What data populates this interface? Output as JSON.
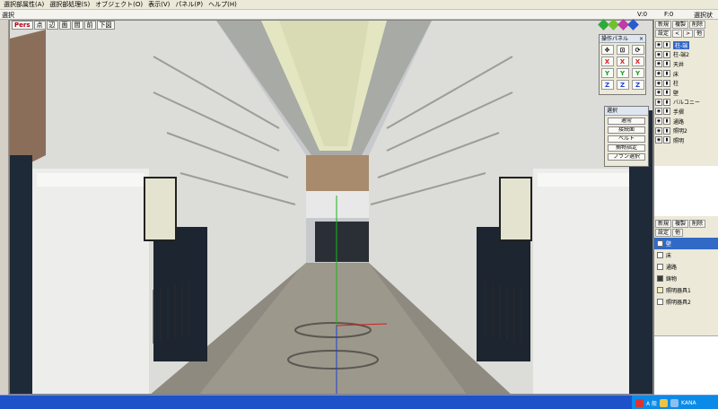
{
  "menu": {
    "items": [
      "選択部属性(A)",
      "選択部処理(S)",
      "オブジェクト(O)",
      "表示(V)",
      "パネル(P)",
      "ヘルプ(H)"
    ]
  },
  "status": {
    "left": "選択",
    "v_label": "V:0",
    "f_label": "F:0",
    "right": "選択状況"
  },
  "viewport_toolbar": {
    "buttons": [
      "Pers",
      "点",
      "辺",
      "面",
      "間",
      "前",
      "下図"
    ]
  },
  "nav_icons": {
    "colors": [
      "#2eaa3a",
      "#6ec12e",
      "#c03aa8",
      "#2a5ad0"
    ]
  },
  "operation_panel": {
    "title": "操作パネル",
    "close_label": "×",
    "row1": [
      "✥",
      "⊡",
      "⟳"
    ],
    "row2": [
      "X",
      "X",
      "X"
    ],
    "row3": [
      "Y",
      "Y",
      "Y"
    ],
    "row4": [
      "Z",
      "Z",
      "Z"
    ],
    "axis_colors": {
      "x": "#d42020",
      "y": "#14a01e",
      "z": "#2040d0"
    }
  },
  "select_panel": {
    "title": "選択",
    "options": [
      "通常",
      "接続面",
      "ベルト",
      "摘物指定",
      "プラン選択"
    ]
  },
  "object_panel": {
    "buttons": [
      "新規",
      "複製",
      "削除",
      "設定",
      "<",
      ">",
      "他"
    ],
    "items": [
      {
        "label": "柱-端",
        "selected": true
      },
      {
        "label": "柱-端2",
        "selected": false
      },
      {
        "label": "天井",
        "selected": false
      },
      {
        "label": "床",
        "selected": false
      },
      {
        "label": "柱",
        "selected": false
      },
      {
        "label": "壁",
        "selected": false
      },
      {
        "label": "バルコニー",
        "selected": false
      },
      {
        "label": "手摺",
        "selected": false
      },
      {
        "label": "通路",
        "selected": false
      },
      {
        "label": "照明2",
        "selected": false
      },
      {
        "label": "照明",
        "selected": false
      }
    ]
  },
  "material_panel": {
    "buttons": [
      "新規",
      "複製",
      "削除",
      "設定",
      "他"
    ],
    "items": [
      {
        "label": "壁",
        "color": "#ffffff",
        "selected": true
      },
      {
        "label": "床",
        "color": "#ffffff",
        "selected": false
      },
      {
        "label": "通路",
        "color": "#ffffff",
        "selected": false
      },
      {
        "label": "鋳物",
        "color": "#3a3a3a",
        "selected": false
      },
      {
        "label": "照明器具1",
        "color": "#f2eeb8",
        "selected": false
      },
      {
        "label": "照明器具2",
        "color": "#ffffff",
        "selected": false
      }
    ]
  },
  "taskbar": {
    "tray_text": "A 般",
    "clock": "KANA"
  },
  "colors": {
    "menu_bg": "#ece9d8",
    "selection": "#3169c6",
    "taskbar": "#1d52c9"
  }
}
